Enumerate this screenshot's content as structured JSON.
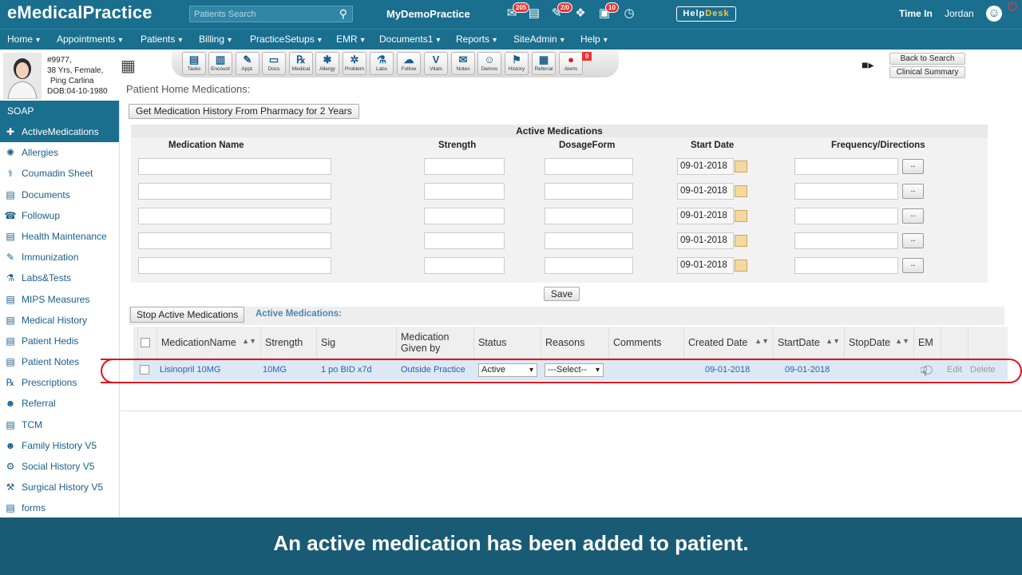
{
  "header": {
    "logo": "eMedicalPractice",
    "search_placeholder": "Patients Search",
    "practice_name": "MyDemoPractice",
    "badges": {
      "messages": "205",
      "tasks": "2/0",
      "notifications": "10"
    },
    "helpdesk_help": "Help",
    "helpdesk_desk": "Desk",
    "time_in": "Time In",
    "user": "Jordan"
  },
  "nav": [
    "Home",
    "Appointments",
    "Patients",
    "Billing",
    "PracticeSetups",
    "EMR",
    "Documents1",
    "Reports",
    "SiteAdmin",
    "Help"
  ],
  "patient": {
    "id_line": "#9977,",
    "age_line": "38 Yrs, Female,",
    "name": "Ping Carlina",
    "dob": "DOB:04-10-1980"
  },
  "toolbar": [
    "Tasks",
    "Encount",
    "Appt.",
    "Docs",
    "Medical",
    "Allergy",
    "Problem",
    "Labs",
    "Follow",
    "Vitals",
    "Notes",
    "Demos",
    "History",
    "Referral",
    "Alerts"
  ],
  "toolbar_glyphs": [
    "▤",
    "▥",
    "✎",
    "▭",
    "℞",
    "✱",
    "✲",
    "⚗",
    "☁",
    "V",
    "✉",
    "☺",
    "⚑",
    "▦",
    "●"
  ],
  "alerts_count": "0",
  "right_buttons": {
    "back": "Back to Search",
    "summary": "Clinical Summary"
  },
  "page_title": "Patient Home Medications:",
  "sidebar": {
    "header": "SOAP",
    "items": [
      "ActiveMedications",
      "Allergies",
      "Coumadin Sheet",
      "Documents",
      "Followup",
      "Health Maintenance",
      "Immunization",
      "Labs&Tests",
      "MIPS Measures",
      "Medical History",
      "Patient Hedis",
      "Patient Notes",
      "Prescriptions",
      "Referral",
      "TCM",
      "Family History V5",
      "Social History V5",
      "Surgical History V5",
      "forms"
    ],
    "icons": [
      "✚",
      "✺",
      "⚕",
      "▤",
      "☎",
      "▤",
      "✎",
      "⚗",
      "▤",
      "▤",
      "▤",
      "▤",
      "℞",
      "☻",
      "▤",
      "☻",
      "⚙",
      "⚒",
      "▤"
    ]
  },
  "pharmacy_button": "Get Medication History From Pharmacy for 2 Years",
  "active_form": {
    "title": "Active Medications",
    "headers": [
      "Medication Name",
      "Strength",
      "DosageForm",
      "Start Date",
      "Frequency/Directions"
    ],
    "start_dates": [
      "09-01-2018",
      "09-01-2018",
      "09-01-2018",
      "09-01-2018",
      "09-01-2018"
    ],
    "dots": "..",
    "save": "Save"
  },
  "stop_button": "Stop Active Medications",
  "stop_label": "Active Medications:",
  "grid": {
    "headers": [
      "MedicationName",
      "Strength",
      "Sig",
      "Medication Given by",
      "Status",
      "Reasons",
      "Comments",
      "Created Date",
      "StartDate",
      "StopDate",
      "EM"
    ],
    "row": {
      "medication": "Lisinopril 10MG",
      "strength": "10MG",
      "sig": "1 po BID x7d",
      "given_by": "Outside Practice",
      "status": "Active",
      "reason": "---Select--",
      "comments": "",
      "created": "09-01-2018",
      "start": "09-01-2018",
      "stop": "",
      "edit": "Edit",
      "delete": "Delete"
    }
  },
  "caption": "An active medication has been added to patient."
}
